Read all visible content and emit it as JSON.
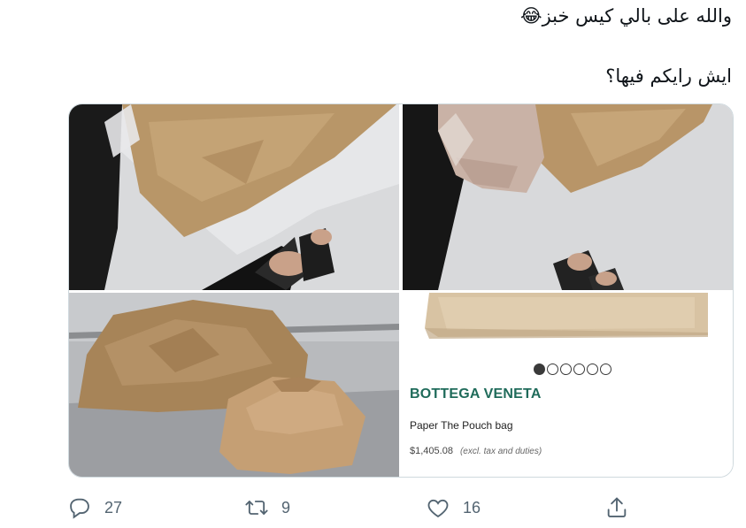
{
  "tweet": {
    "line1": "والله على بالي كيس خبز😂",
    "line2": "ايش رايكم فيها؟"
  },
  "product_card": {
    "brand": "BOTTEGA VENETA",
    "product_name": "Paper The Pouch bag",
    "price": "$1,405.08",
    "price_note": "(excl. tax and duties)",
    "carousel_total": 6,
    "carousel_active": 1,
    "brand_color": "#1f6b5a"
  },
  "actions": {
    "reply_count": "27",
    "retweet_count": "9",
    "like_count": "16"
  },
  "colors": {
    "text": "#0f1419",
    "secondary": "#536471",
    "border": "#cfd9de"
  },
  "icons": [
    "reply-icon",
    "retweet-icon",
    "like-icon",
    "share-icon"
  ]
}
